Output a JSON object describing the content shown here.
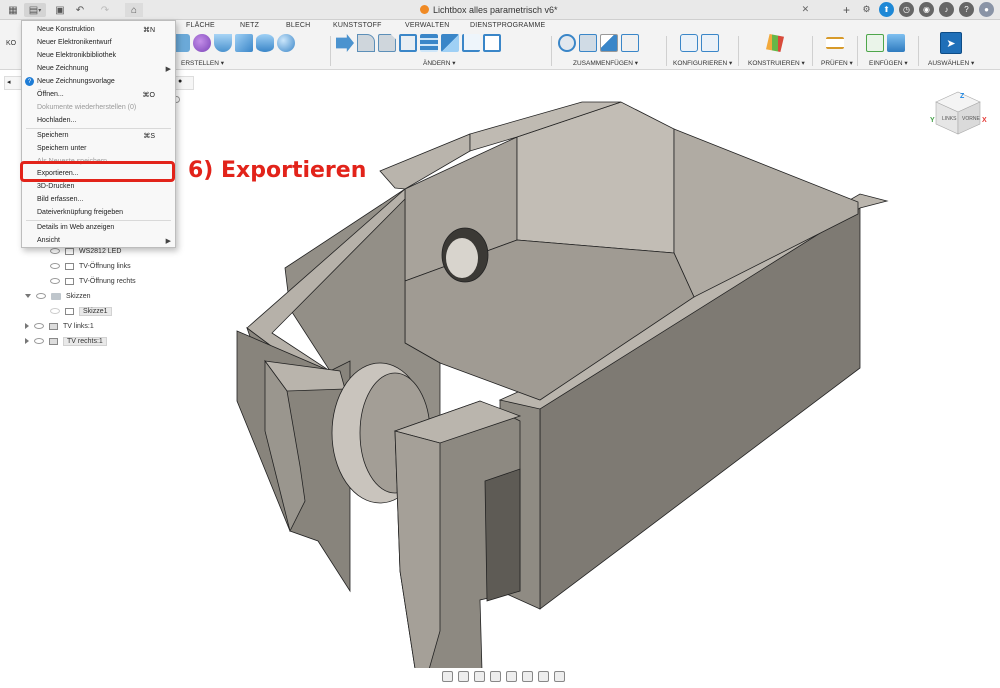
{
  "title_bar": {
    "document_title": "Lichtbox alles parametrisch v6*"
  },
  "ribbon": {
    "workspace_label": "KO",
    "tabs": [
      "FLÄCHE",
      "NETZ",
      "BLECH",
      "KUNSTSTOFF",
      "VERWALTEN",
      "DIENSTPROGRAMME"
    ],
    "groups": [
      "ERSTELLEN ▾",
      "ÄNDERN ▾",
      "ZUSAMMENFÜGEN ▾",
      "KONFIGURIEREN ▾",
      "KONSTRUIEREN ▾",
      "PRÜFEN ▾",
      "EINFÜGEN ▾",
      "AUSWÄHLEN ▾"
    ]
  },
  "file_menu": {
    "items": [
      {
        "label": "Neue Konstruktion",
        "shortcut": "⌘N"
      },
      {
        "label": "Neuer Elektronikentwurf"
      },
      {
        "label": "Neue Elektronikbibliothek"
      },
      {
        "label": "Neue Zeichnung",
        "submenu": "▶"
      },
      {
        "label": "Neue Zeichnungsvorlage"
      },
      {
        "label": "Öffnen...",
        "shortcut": "⌘O"
      },
      {
        "label": "Dokumente wiederherstellen (0)"
      },
      {
        "label": "Hochladen..."
      },
      {
        "label": "Speichern",
        "shortcut": "⌘S"
      },
      {
        "label": "Speichern unter"
      },
      {
        "label": "Als Neueste speichern"
      },
      {
        "label": "Exportieren..."
      },
      {
        "label": "3D-Drucken"
      },
      {
        "label": "Bild erfassen..."
      },
      {
        "label": "Dateiverknüpfung freigeben"
      },
      {
        "label": "Details im Web anzeigen"
      },
      {
        "label": "Ansicht",
        "submenu": "▶"
      }
    ]
  },
  "annotation": {
    "callout_text": "6) Exportieren"
  },
  "browser": {
    "rows": [
      {
        "label": "WS2812 LED"
      },
      {
        "label": "TV-Öffnung links"
      },
      {
        "label": "TV-Öffnung rechts"
      },
      {
        "label": "Skizzen"
      },
      {
        "label": "Skizze1"
      },
      {
        "label": "TV links:1"
      },
      {
        "label": "TV rechts:1"
      }
    ]
  },
  "viewcube": {
    "front_label": "LINKS",
    "right_label": "VORNE",
    "axis_x": "X",
    "axis_y": "Y",
    "axis_z": "Z"
  },
  "colors": {
    "accent_red": "#e2231a",
    "model_face_light": "#b3aea6",
    "model_face_dark": "#827e76",
    "brand_orange": "#f08a24"
  }
}
